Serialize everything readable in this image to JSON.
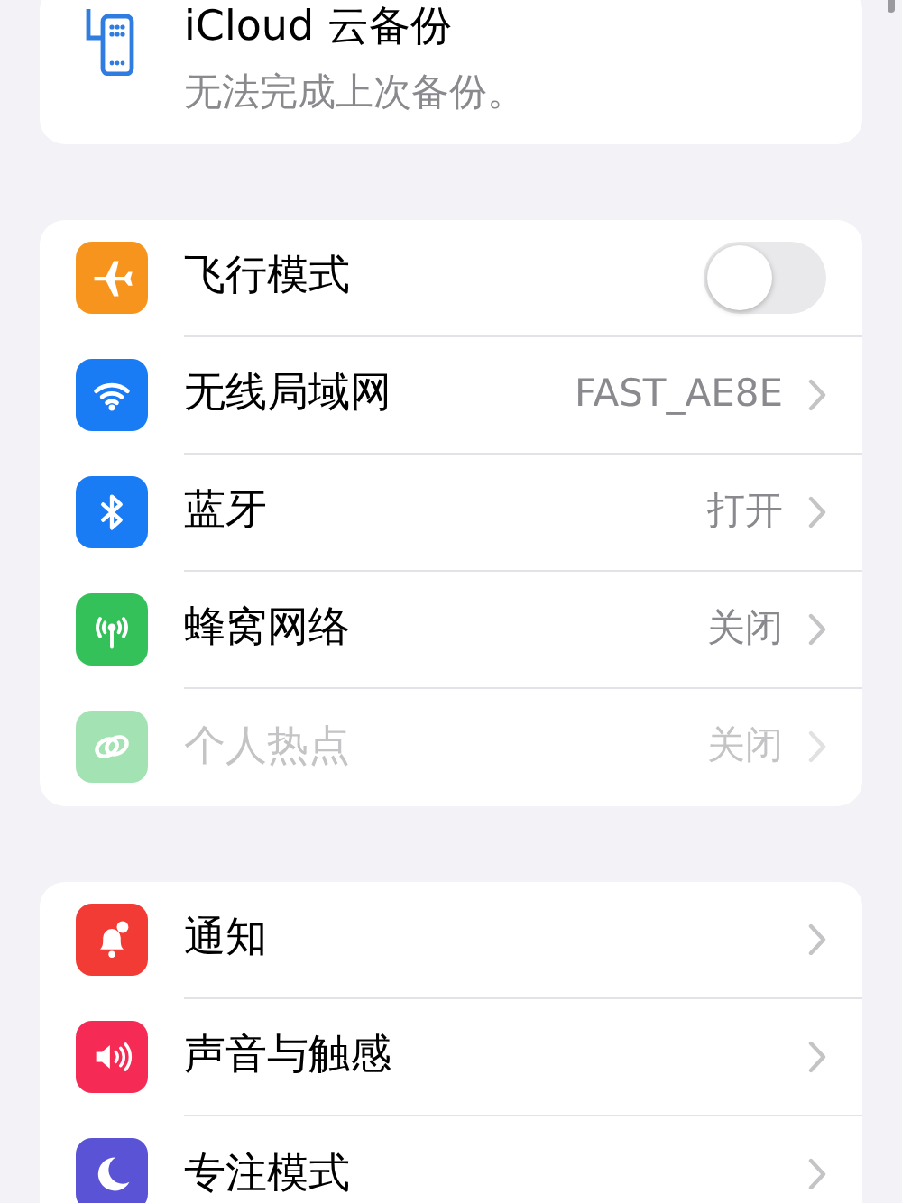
{
  "backup_card": {
    "title": "iCloud 云备份",
    "subtitle": "无法完成上次备份。"
  },
  "groups": [
    {
      "rows": [
        {
          "kind": "toggle",
          "label": "飞行模式",
          "color": "#f7941d",
          "on": false,
          "disabled": false
        },
        {
          "kind": "link",
          "label": "无线局域网",
          "value": "FAST_AE8E",
          "color": "#1a7cf5",
          "disabled": false
        },
        {
          "kind": "link",
          "label": "蓝牙",
          "value": "打开",
          "color": "#1a7cf5",
          "disabled": false
        },
        {
          "kind": "link",
          "label": "蜂窝网络",
          "value": "关闭",
          "color": "#35c15a",
          "disabled": false
        },
        {
          "kind": "link",
          "label": "个人热点",
          "value": "关闭",
          "color": "#a3e2b3",
          "disabled": true
        }
      ]
    },
    {
      "rows": [
        {
          "kind": "link",
          "label": "通知",
          "color": "#f23b35",
          "disabled": false
        },
        {
          "kind": "link",
          "label": "声音与触感",
          "color": "#f52b55",
          "disabled": false
        },
        {
          "kind": "link",
          "label": "专注模式",
          "color": "#5b53d6",
          "disabled": false
        }
      ]
    }
  ]
}
